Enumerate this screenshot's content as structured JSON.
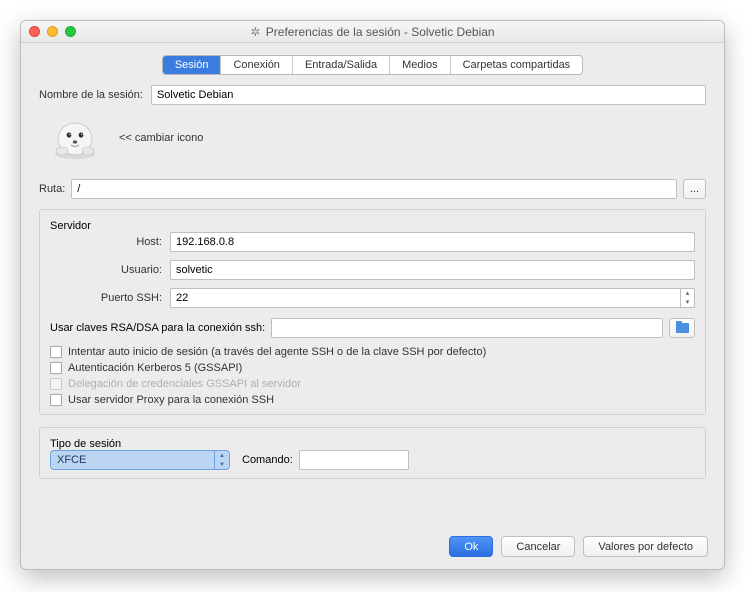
{
  "window": {
    "title": "Preferencias de la sesión - Solvetic Debian"
  },
  "tabs": {
    "session": "Sesión",
    "connection": "Conexión",
    "io": "Entrada/Salida",
    "media": "Medios",
    "shared": "Carpetas compartidas"
  },
  "session_name": {
    "label": "Nombre de la sesión:",
    "value": "Solvetic Debian"
  },
  "change_icon_label": "<< cambiar icono",
  "path": {
    "label": "Ruta:",
    "value": "/",
    "browse": "..."
  },
  "server": {
    "legend": "Servidor",
    "host_label": "Host:",
    "host_value": "192.168.0.8",
    "user_label": "Usuario:",
    "user_value": "solvetic",
    "port_label": "Puerto SSH:",
    "port_value": "22",
    "rsa_label": "Usar claves RSA/DSA para la conexión ssh:",
    "rsa_value": "",
    "chk_autologin": "Intentar auto inicio de sesión (a través del agente SSH o de la clave SSH por defecto)",
    "chk_kerberos": "Autenticación Kerberos 5 (GSSAPI)",
    "chk_gssapi_delegation": "Delegación de credenciales GSSAPI al servidor",
    "chk_proxy": "Usar servidor Proxy para la conexión SSH"
  },
  "session_type": {
    "legend": "Tipo de sesión",
    "value": "XFCE",
    "command_label": "Comando:",
    "command_value": ""
  },
  "buttons": {
    "ok": "Ok",
    "cancel": "Cancelar",
    "defaults": "Valores por defecto"
  }
}
